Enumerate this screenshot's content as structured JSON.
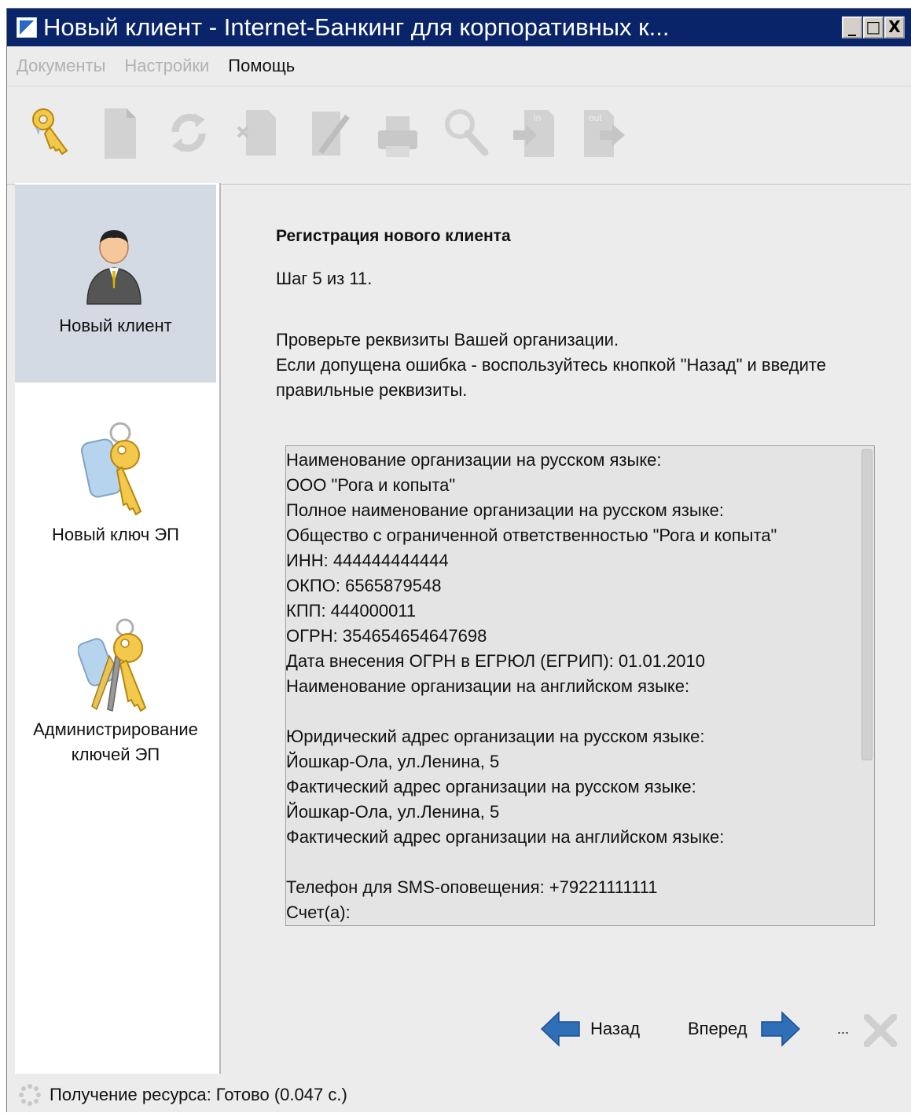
{
  "window": {
    "title": "Новый клиент - Internet-Банкинг для корпоративных к...",
    "controls": {
      "minimize": "_",
      "maximize": "□",
      "close": "X"
    }
  },
  "menu": [
    {
      "label": "Документы",
      "enabled": false
    },
    {
      "label": "Настройки",
      "enabled": false
    },
    {
      "label": "Помощь",
      "enabled": true
    }
  ],
  "toolbar": {
    "buttons": [
      "keys-icon",
      "new-document-icon",
      "refresh-icon",
      "delete-document-icon",
      "edit-document-icon",
      "print-icon",
      "search-icon",
      "import-icon",
      "export-icon"
    ],
    "import_label": "in",
    "export_label": "out"
  },
  "sidebar": {
    "items": [
      {
        "label": "Новый клиент",
        "icon": "user-icon",
        "selected": true
      },
      {
        "label": "Новый ключ ЭП",
        "icon": "key-icon",
        "selected": false
      },
      {
        "label": "Администрирование ключей ЭП",
        "icon": "keys-bunch-icon",
        "selected": false
      }
    ]
  },
  "main": {
    "heading": "Регистрация нового клиента",
    "step": "Шаг 5 из 11.",
    "instruction_1": "Проверьте реквизиты Вашей организации.",
    "instruction_2": "Если допущена ошибка - воспользуйтесь кнопкой \"Назад\" и введите правильные реквизиты.",
    "details": [
      "Наименование организации на русском языке:",
      "ООО \"Рога и копыта\"",
      "Полное наименование организации на русском языке:",
      "Общество с ограниченной ответственностью \"Рога и копыта\"",
      "ИНН: 444444444444",
      "ОКПО: 6565879548",
      "КПП: 444000011",
      "ОГРН: 354654654647698",
      "Дата внесения ОГРН в ЕГРЮЛ (ЕГРИП): 01.01.2010",
      "Наименование организации на английском языке:",
      "",
      "Юридический адрес организации на русском языке:",
      "Йошкар-Ола, ул.Ленина, 5",
      "Фактический адрес организации на русском языке:",
      "Йошкар-Ола, ул.Ленина, 5",
      "Фактический адрес организации на английском языке:",
      "",
      "Телефон для SMS-оповещения: +79221111111",
      "Счет(а):"
    ]
  },
  "footer_buttons": {
    "back": "Назад",
    "forward": "Вперед",
    "more": "...",
    "cancel_icon": "close-icon"
  },
  "status": {
    "text": "Получение ресурса: Готово (0.047 с.)"
  },
  "colors": {
    "titlebar": "#0a246a",
    "sidebar_selected": "#d3dae3",
    "arrow_blue": "#2f6fb8",
    "disabled_menu": "#b2b2b2"
  }
}
